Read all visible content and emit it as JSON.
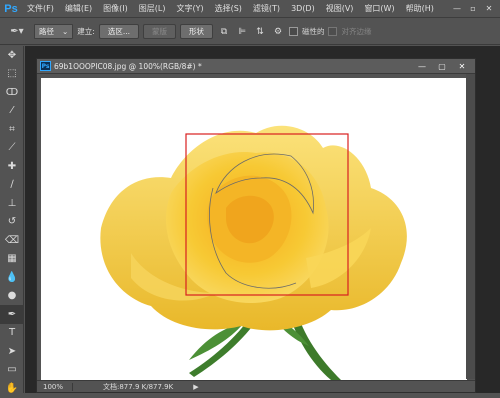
{
  "app": {
    "logo": "Ps",
    "menu": [
      "文件(F)",
      "编辑(E)",
      "图像(I)",
      "图层(L)",
      "文字(Y)",
      "选择(S)",
      "滤镜(T)",
      "3D(D)",
      "视图(V)",
      "窗口(W)",
      "帮助(H)"
    ]
  },
  "options": {
    "mode": "路径",
    "build_label": "建立:",
    "selection_btn": "选区...",
    "mask_btn": "蒙版",
    "shape_btn": "形状",
    "magnetic_label": "磁性的",
    "align_edges_label": "对齐边缘"
  },
  "document": {
    "title": "69b1OOOPIC08.jpg @ 100%(RGB/8#) *",
    "zoom": "100%",
    "doc_info": "文档:877.9 K/877.9K"
  },
  "colors": {
    "accent": "#31a8ff",
    "selection_rect": "#d82020",
    "rose": "#f5c52c"
  }
}
